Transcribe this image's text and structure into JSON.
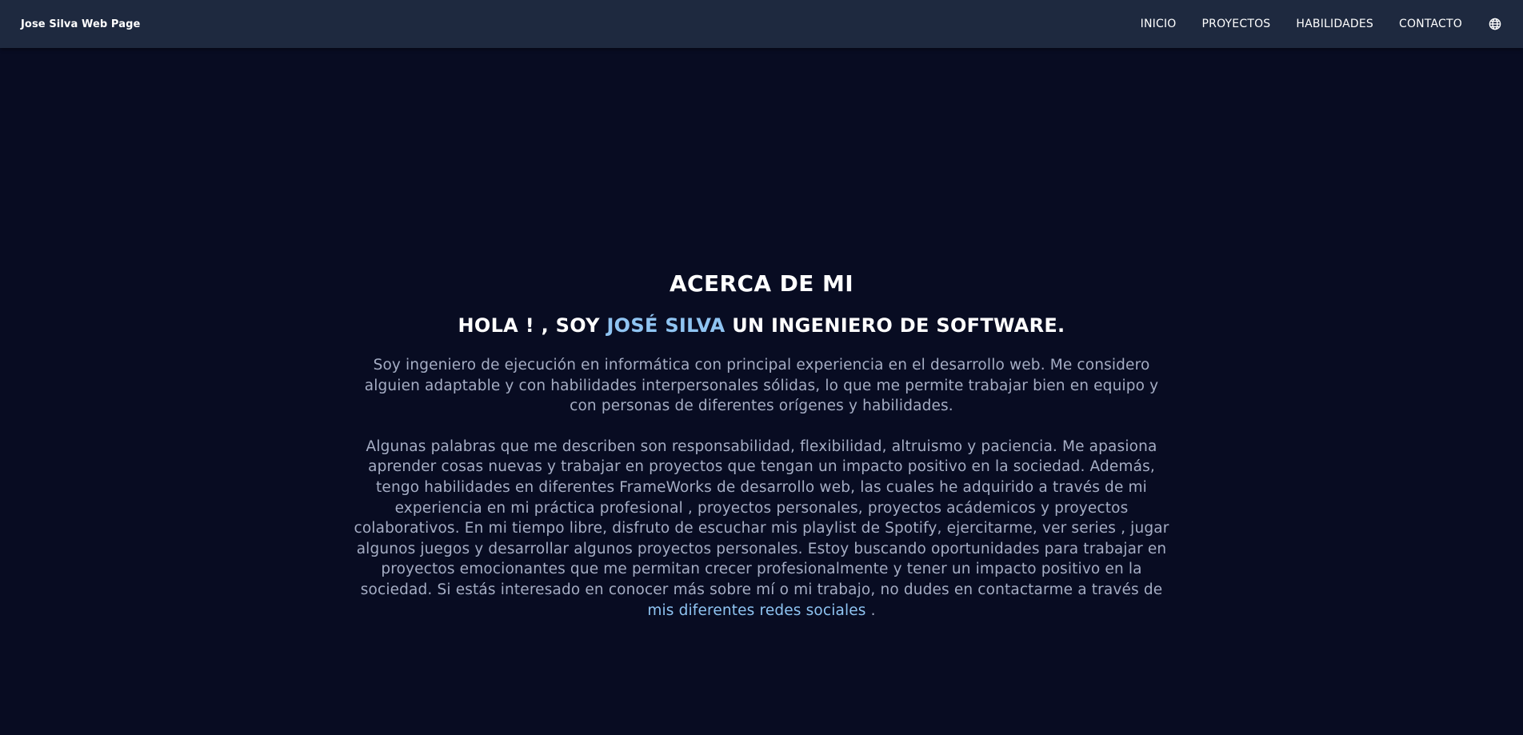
{
  "navbar": {
    "brand": "Jose Silva Web Page",
    "links": [
      {
        "label": "INICIO"
      },
      {
        "label": "PROYECTOS"
      },
      {
        "label": "HABILIDADES"
      },
      {
        "label": "CONTACTO"
      }
    ],
    "language_icon": "globe-icon"
  },
  "about": {
    "title": "ACERCA DE MI",
    "greeting_prefix": "HOLA ! , SOY ",
    "greeting_name": "JOSÉ SILVA",
    "greeting_suffix": " UN INGENIERO DE SOFTWARE.",
    "paragraph1": "Soy ingeniero de ejecución en informática con principal experiencia en el desarrollo web. Me considero alguien adaptable y con habilidades interpersonales sólidas, lo que me permite trabajar bien en equipo y con personas de diferentes orígenes y habilidades.",
    "paragraph2": "Algunas palabras que me describen son responsabilidad, flexibilidad, altruismo y paciencia. Me apasiona aprender cosas nuevas y trabajar en proyectos que tengan un impacto positivo en la sociedad. Además, tengo habilidades en diferentes FrameWorks de desarrollo web, las cuales he adquirido a través de mi experiencia en mi práctica profesional , proyectos personales, proyectos acádemicos y proyectos colaborativos. En mi tiempo libre, disfruto de escuchar mis playlist de Spotify, ejercitarme, ver series , jugar algunos juegos y desarrollar algunos proyectos personales. Estoy buscando oportunidades para trabajar en proyectos emocionantes que me permitan crecer profesionalmente y tener un impacto positivo en la sociedad. Si estás interesado en conocer más sobre mí o mi trabajo, no dudes en contactarme a través de ",
    "social_link": "mis diferentes redes sociales",
    "paragraph2_end": " ."
  },
  "colors": {
    "background": "#080c22",
    "navbar": "#1e293f",
    "accent": "#8fc4f2",
    "body_text": "#a5adc4"
  }
}
